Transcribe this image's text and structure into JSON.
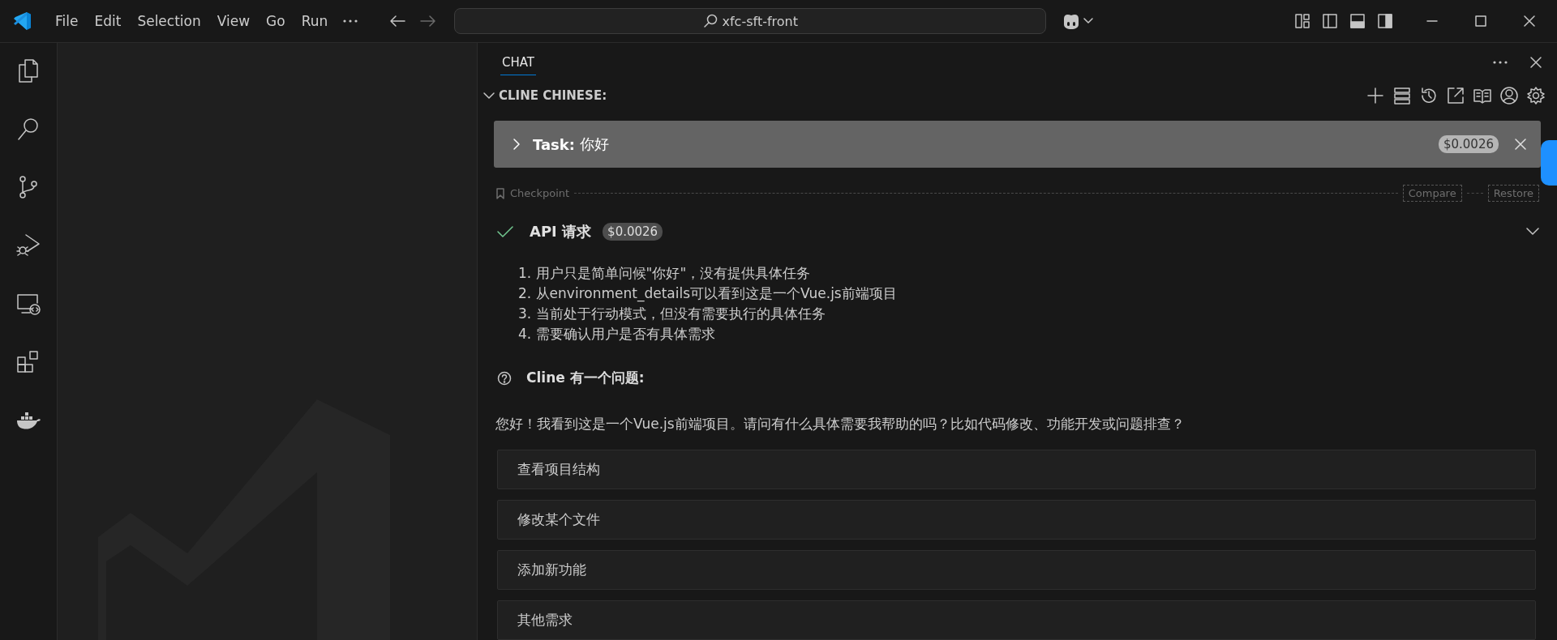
{
  "title_bar": {
    "menu": [
      {
        "label": "File"
      },
      {
        "label": "Edit"
      },
      {
        "label": "Selection"
      },
      {
        "label": "View"
      },
      {
        "label": "Go"
      },
      {
        "label": "Run"
      }
    ],
    "search": "xfc-sft-front"
  },
  "panel": {
    "tabs": [
      {
        "label": "CHAT",
        "selected": true
      }
    ],
    "section": {
      "title": "CLINE CHINESE:",
      "expanded": true
    },
    "task": {
      "label": "Task:",
      "text": "你好",
      "cost": "$0.0026",
      "expanded": false
    },
    "checkpoint": {
      "label": "Checkpoint",
      "buttons": [
        {
          "label": "Compare"
        },
        {
          "label": "Restore"
        }
      ]
    },
    "api_request": {
      "title": "API 请求",
      "cost": "$0.0026",
      "completed": true
    },
    "reasoning": [
      "1. 用户只是简单问候\"你好\"，没有提供具体任务",
      "2. 从environment_details可以看到这是一个Vue.js前端项目",
      "3. 当前处于行动模式，但没有需要执行的具体任务",
      "4. 需要确认用户是否有具体需求"
    ],
    "question": {
      "title": "Cline 有一个问题:",
      "text": "您好！我看到这是一个Vue.js前端项目。请问有什么具体需要我帮助的吗？比如代码修改、功能开发或问题排查？",
      "options": [
        {
          "label": "查看项目结构"
        },
        {
          "label": "修改某个文件"
        },
        {
          "label": "添加新功能"
        },
        {
          "label": "其他需求"
        }
      ]
    }
  }
}
